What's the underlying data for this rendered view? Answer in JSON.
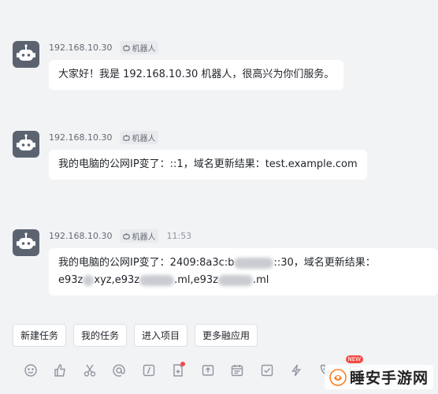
{
  "messages": [
    {
      "sender_ip": "192.168.10.30",
      "tag": "机器人",
      "time": "",
      "line1": "大家好！我是 192.168.10.30 机器人，很高兴为你们服务。"
    },
    {
      "sender_ip": "192.168.10.30",
      "tag": "机器人",
      "time": "",
      "line1": "我的电脑的公网IP变了：::1，域名更新结果：test.example.com"
    },
    {
      "sender_ip": "192.168.10.30",
      "tag": "机器人",
      "time": "11:53",
      "line1_a": "我的电脑的公网IP变了：2409:8a3c:b",
      "line1_b": "::30，域名更新结果：",
      "line2_a": "e93z",
      "line2_b": "xyz,e93z",
      "line2_c": ".ml,e93z",
      "line2_d": ".ml"
    }
  ],
  "quick_actions": [
    "新建任务",
    "我的任务",
    "进入项目",
    "更多融应用"
  ],
  "toolbar": {
    "icons": [
      "emoji-icon",
      "thumbs-up-icon",
      "scissors-icon",
      "mention-icon",
      "slash-command-icon",
      "add-doc-icon",
      "upload-icon",
      "calendar-icon",
      "checkbox-icon",
      "lightning-icon",
      "phone-icon",
      "new-feature-icon",
      "more-icon"
    ],
    "new_badge": "NEW"
  },
  "watermark": {
    "text": "睡安手游网"
  },
  "colors": {
    "background": "#f2f3f5",
    "bubble": "#ffffff",
    "avatar": "#5b6370",
    "accent_red": "#f54a45"
  }
}
